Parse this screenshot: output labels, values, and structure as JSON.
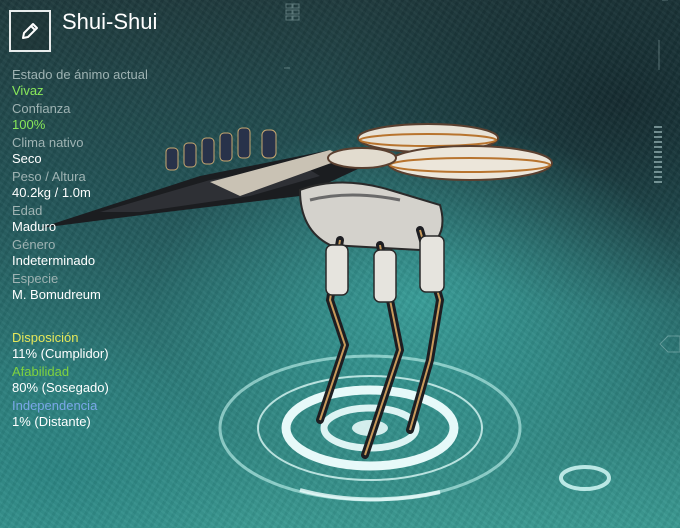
{
  "creature": {
    "name": "Shui-Shui"
  },
  "stats": [
    {
      "label": "Estado de ánimo actual",
      "value": "Vivaz",
      "highlight": true
    },
    {
      "label": "Confianza",
      "value": "100%",
      "highlight": true
    },
    {
      "label": "Clima nativo",
      "value": "Seco",
      "highlight": false
    },
    {
      "label": "Peso / Altura",
      "value": "40.2kg / 1.0m",
      "highlight": false
    },
    {
      "label": "Edad",
      "value": "Maduro",
      "highlight": false
    },
    {
      "label": "Género",
      "value": "Indeterminado",
      "highlight": false
    },
    {
      "label": "Especie",
      "value": "M. Bomudreum",
      "highlight": false
    }
  ],
  "traits": [
    {
      "label": "Disposición",
      "value": "11% (Cumplidor)",
      "color": "#e7e85a"
    },
    {
      "label": "Afabilidad",
      "value": "80% (Sosegado)",
      "color": "#7fd23e"
    },
    {
      "label": "Independencia",
      "value": "1% (Distante)",
      "color": "#7aa7e8"
    }
  ],
  "icons": {
    "edit": "pencil-icon"
  },
  "colors": {
    "highlight_green": "#88e85a",
    "label_gray": "#9fb3b3"
  }
}
